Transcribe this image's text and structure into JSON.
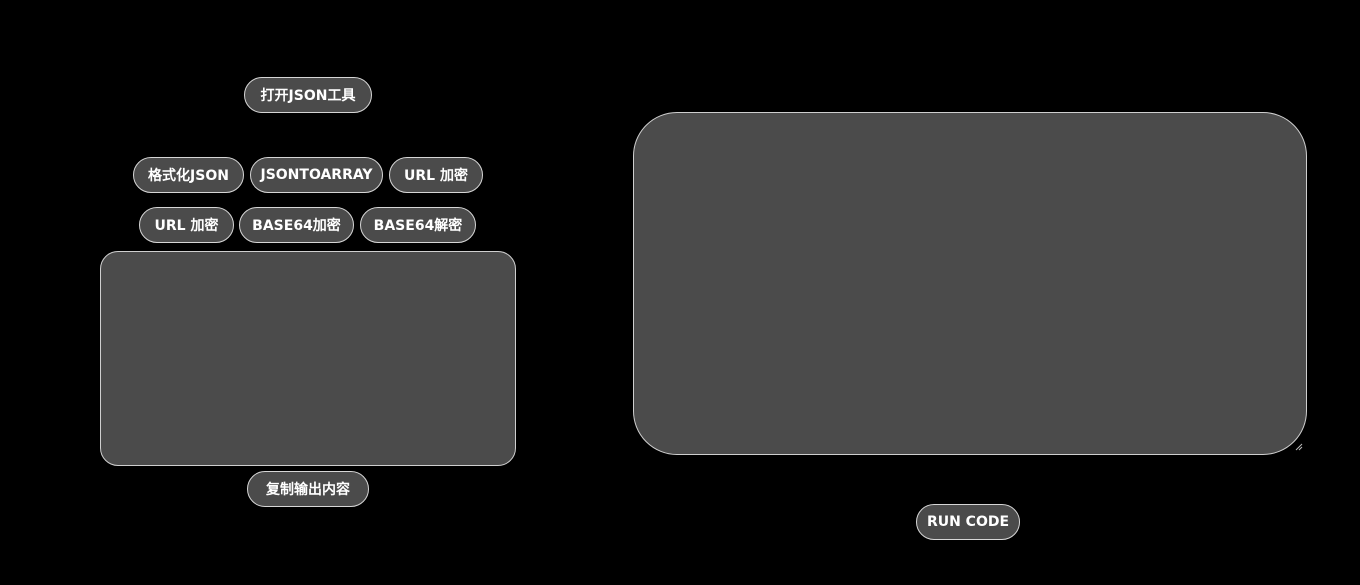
{
  "json_tools": {
    "open_label": "打开JSON工具",
    "row1": [
      {
        "label": "格式化JSON"
      },
      {
        "label": "JSONTOARRAY"
      },
      {
        "label": "URL 加密"
      }
    ],
    "row2": [
      {
        "label": "URL 加密"
      },
      {
        "label": "BASE64加密"
      },
      {
        "label": "BASE64解密"
      }
    ],
    "output_value": "",
    "copy_label": "复制输出内容"
  },
  "code_panel": {
    "editor_value": "",
    "run_label": "RUN CODE"
  },
  "colors": {
    "background": "#000000",
    "control_fill": "#4b4b4b",
    "control_border": "#d6d6d6",
    "text": "#ffffff"
  }
}
